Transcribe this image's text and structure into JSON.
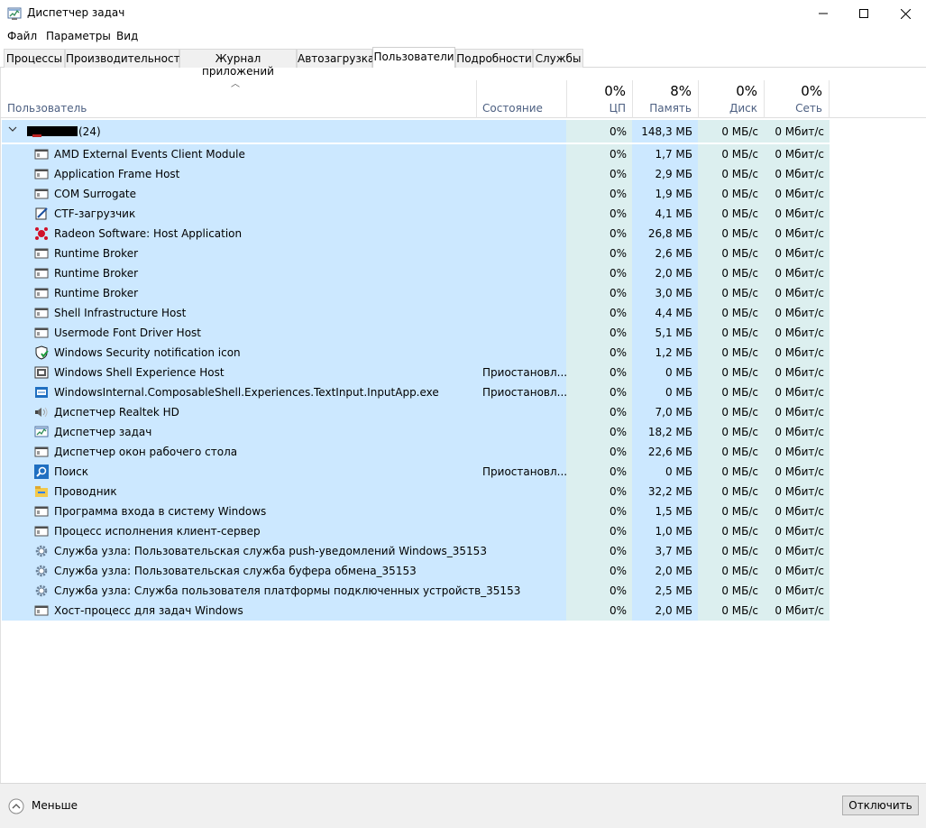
{
  "window": {
    "title": "Диспетчер задач"
  },
  "menu": [
    "Файл",
    "Параметры",
    "Вид"
  ],
  "tabs": [
    "Процессы",
    "Производительность",
    "Журнал приложений",
    "Автозагрузка",
    "Пользователи",
    "Подробности",
    "Службы"
  ],
  "active_tab": "Пользователи",
  "columns": {
    "user": "Пользователь",
    "state": "Состояние",
    "cpu": {
      "pct": "0%",
      "label": "ЦП"
    },
    "memory": {
      "pct": "8%",
      "label": "Память"
    },
    "disk": {
      "pct": "0%",
      "label": "Диск"
    },
    "network": {
      "pct": "0%",
      "label": "Сеть"
    }
  },
  "user_group": {
    "count": "(24)",
    "cpu": "0%",
    "memory": "148,3 МБ",
    "disk": "0 МБ/с",
    "network": "0 Мбит/с"
  },
  "processes": [
    {
      "icon": "window-icon",
      "name": "AMD External Events Client Module",
      "state": "",
      "cpu": "0%",
      "memory": "1,7 МБ",
      "disk": "0 МБ/с",
      "network": "0 Мбит/с"
    },
    {
      "icon": "window-icon",
      "name": "Application Frame Host",
      "state": "",
      "cpu": "0%",
      "memory": "2,9 МБ",
      "disk": "0 МБ/с",
      "network": "0 Мбит/с"
    },
    {
      "icon": "window-icon",
      "name": "COM Surrogate",
      "state": "",
      "cpu": "0%",
      "memory": "1,9 МБ",
      "disk": "0 МБ/с",
      "network": "0 Мбит/с"
    },
    {
      "icon": "ctf-icon",
      "name": "CTF-загрузчик",
      "state": "",
      "cpu": "0%",
      "memory": "4,1 МБ",
      "disk": "0 МБ/с",
      "network": "0 Мбит/с"
    },
    {
      "icon": "radeon-icon",
      "name": "Radeon Software: Host Application",
      "state": "",
      "cpu": "0%",
      "memory": "26,8 МБ",
      "disk": "0 МБ/с",
      "network": "0 Мбит/с"
    },
    {
      "icon": "window-icon",
      "name": "Runtime Broker",
      "state": "",
      "cpu": "0%",
      "memory": "2,6 МБ",
      "disk": "0 МБ/с",
      "network": "0 Мбит/с"
    },
    {
      "icon": "window-icon",
      "name": "Runtime Broker",
      "state": "",
      "cpu": "0%",
      "memory": "2,0 МБ",
      "disk": "0 МБ/с",
      "network": "0 Мбит/с"
    },
    {
      "icon": "window-icon",
      "name": "Runtime Broker",
      "state": "",
      "cpu": "0%",
      "memory": "3,0 МБ",
      "disk": "0 МБ/с",
      "network": "0 Мбит/с"
    },
    {
      "icon": "window-icon",
      "name": "Shell Infrastructure Host",
      "state": "",
      "cpu": "0%",
      "memory": "4,4 МБ",
      "disk": "0 МБ/с",
      "network": "0 Мбит/с"
    },
    {
      "icon": "window-icon",
      "name": "Usermode Font Driver Host",
      "state": "",
      "cpu": "0%",
      "memory": "5,1 МБ",
      "disk": "0 МБ/с",
      "network": "0 Мбит/с"
    },
    {
      "icon": "shield-icon",
      "name": "Windows Security notification icon",
      "state": "",
      "cpu": "0%",
      "memory": "1,2 МБ",
      "disk": "0 МБ/с",
      "network": "0 Мбит/с"
    },
    {
      "icon": "shell-icon",
      "name": "Windows Shell Experience Host",
      "state": "Приостановл...",
      "cpu": "0%",
      "memory": "0 МБ",
      "disk": "0 МБ/с",
      "network": "0 Мбит/с"
    },
    {
      "icon": "keyboard-icon",
      "name": "WindowsInternal.ComposableShell.Experiences.TextInput.InputApp.exe",
      "state": "Приостановл...",
      "cpu": "0%",
      "memory": "0 МБ",
      "disk": "0 МБ/с",
      "network": "0 Мбит/с"
    },
    {
      "icon": "speaker-icon",
      "name": "Диспетчер Realtek HD",
      "state": "",
      "cpu": "0%",
      "memory": "7,0 МБ",
      "disk": "0 МБ/с",
      "network": "0 Мбит/с"
    },
    {
      "icon": "task-manager-icon",
      "name": "Диспетчер задач",
      "state": "",
      "cpu": "0%",
      "memory": "18,2 МБ",
      "disk": "0 МБ/с",
      "network": "0 Мбит/с"
    },
    {
      "icon": "window-icon",
      "name": "Диспетчер окон рабочего стола",
      "state": "",
      "cpu": "0%",
      "memory": "22,6 МБ",
      "disk": "0 МБ/с",
      "network": "0 Мбит/с"
    },
    {
      "icon": "search-icon",
      "name": "Поиск",
      "state": "Приостановл...",
      "cpu": "0%",
      "memory": "0 МБ",
      "disk": "0 МБ/с",
      "network": "0 Мбит/с"
    },
    {
      "icon": "explorer-icon",
      "name": "Проводник",
      "state": "",
      "cpu": "0%",
      "memory": "32,2 МБ",
      "disk": "0 МБ/с",
      "network": "0 Мбит/с"
    },
    {
      "icon": "window-icon",
      "name": "Программа входа в систему Windows",
      "state": "",
      "cpu": "0%",
      "memory": "1,5 МБ",
      "disk": "0 МБ/с",
      "network": "0 Мбит/с"
    },
    {
      "icon": "window-icon",
      "name": "Процесс исполнения клиент-сервер",
      "state": "",
      "cpu": "0%",
      "memory": "1,0 МБ",
      "disk": "0 МБ/с",
      "network": "0 Мбит/с"
    },
    {
      "icon": "gear-icon",
      "name": "Служба узла: Пользовательская служба push-уведомлений Windows_35153",
      "state": "",
      "cpu": "0%",
      "memory": "3,7 МБ",
      "disk": "0 МБ/с",
      "network": "0 Мбит/с"
    },
    {
      "icon": "gear-icon",
      "name": "Служба узла: Пользовательская служба буфера обмена_35153",
      "state": "",
      "cpu": "0%",
      "memory": "2,0 МБ",
      "disk": "0 МБ/с",
      "network": "0 Мбит/с"
    },
    {
      "icon": "gear-icon",
      "name": "Служба узла: Служба пользователя платформы подключенных устройств_35153",
      "state": "",
      "cpu": "0%",
      "memory": "2,5 МБ",
      "disk": "0 МБ/с",
      "network": "0 Мбит/с"
    },
    {
      "icon": "window-icon",
      "name": "Хост-процесс для задач Windows",
      "state": "",
      "cpu": "0%",
      "memory": "2,0 МБ",
      "disk": "0 МБ/с",
      "network": "0 Мбит/с"
    }
  ],
  "footer": {
    "less_label": "Меньше",
    "disconnect_label": "Отключить"
  }
}
